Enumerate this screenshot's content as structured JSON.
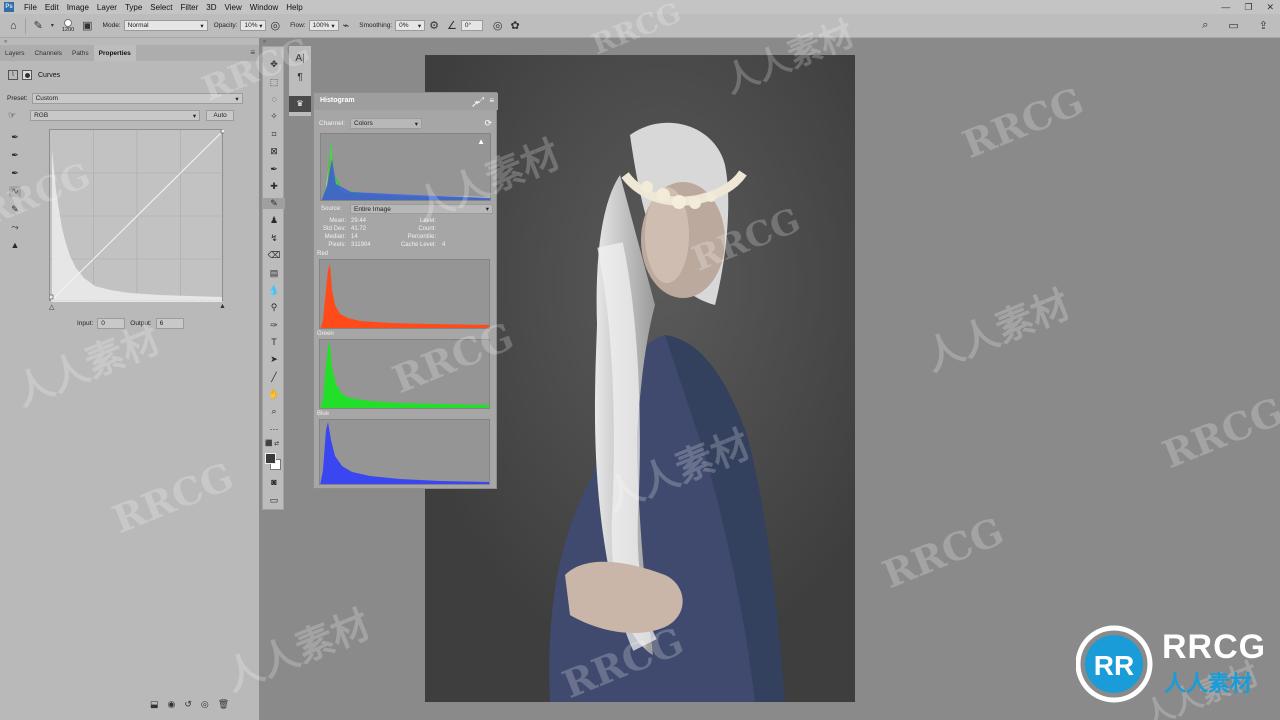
{
  "menubar": {
    "logo": "Ps",
    "items": [
      "File",
      "Edit",
      "Image",
      "Layer",
      "Type",
      "Select",
      "Filter",
      "3D",
      "View",
      "Window",
      "Help"
    ],
    "window_controls": [
      "—",
      "❐",
      "✕"
    ]
  },
  "options": {
    "brush_size": "1200",
    "mode_label": "Mode:",
    "mode_value": "Normal",
    "opacity_label": "Opacity:",
    "opacity_value": "10%",
    "flow_label": "Flow:",
    "flow_value": "100%",
    "smoothing_label": "Smoothing:",
    "smoothing_value": "0%",
    "angle_value": "0°"
  },
  "panel_tabs": [
    "Layers",
    "Channels",
    "Paths",
    "Properties"
  ],
  "properties": {
    "adjustment_name": "Curves",
    "preset_label": "Preset:",
    "preset_value": "Custom",
    "channel_value": "RGB",
    "auto_label": "Auto",
    "input_label": "Input:",
    "input_value": "0",
    "output_label": "Output:",
    "output_value": "6"
  },
  "histogram": {
    "title": "Histogram",
    "channel_label": "Channel:",
    "channel_value": "Colors",
    "source_label": "Source:",
    "source_value": "Entire Image",
    "stats": {
      "mean_label": "Mean:",
      "mean": "29.44",
      "stddev_label": "Std Dev:",
      "stddev": "41.72",
      "median_label": "Median:",
      "median": "14",
      "pixels_label": "Pixels:",
      "pixels": "311904",
      "level_label": "Level:",
      "level": "",
      "count_label": "Count:",
      "count": "",
      "percentile_label": "Percentile:",
      "percentile": "",
      "cache_label": "Cache Level:",
      "cache": "4"
    },
    "channels": [
      {
        "name": "Red",
        "color": "#ff4a1a"
      },
      {
        "name": "Green",
        "color": "#22e02a"
      },
      {
        "name": "Blue",
        "color": "#3a46f0"
      }
    ]
  },
  "watermark": {
    "latin": "RRCG",
    "chinese": "人人素材"
  },
  "logo": {
    "line1": "RRCG",
    "line2": "人人素材",
    "accent": "#1a9cd8"
  },
  "colors": {
    "accent_blue": "#1a9cd8",
    "panel_bg": "#b9b9b9",
    "canvas_bg": "#484848"
  }
}
